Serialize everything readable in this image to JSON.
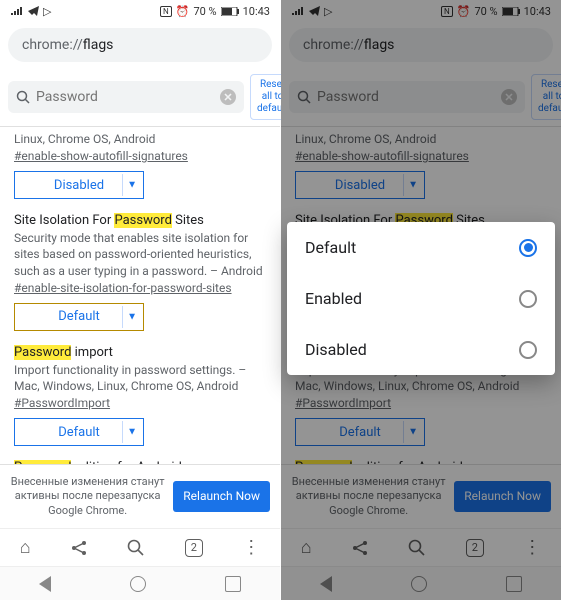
{
  "status": {
    "battery": "70 %",
    "time": "10:43"
  },
  "url": {
    "scheme": "chrome://",
    "path": "flags"
  },
  "search": {
    "placeholder": "Password"
  },
  "reset_btn": "Reset all to default",
  "flags": [
    {
      "title_plain": "Linux, Chrome OS, Android",
      "hash": "#enable-show-autofill-signatures",
      "dd": "Disabled",
      "dd_mod": false
    },
    {
      "title_pre": "Site Isolation For ",
      "title_hl": "Password",
      "title_post": " Sites",
      "desc": "Security mode that enables site isolation for sites based on password-oriented heuristics, such as a user typing in a password. – Android",
      "hash": "#enable-site-isolation-for-password-sites",
      "dd": "Default",
      "dd_mod": true
    },
    {
      "title_hl": "Password",
      "title_post": " import",
      "desc": "Import functionality in password settings. – Mac, Windows, Linux, Chrome OS, Android",
      "hash": "#PasswordImport",
      "dd": "Default",
      "dd_mod": false
    },
    {
      "title_hl": "Password",
      "title_post": " editing for Android"
    }
  ],
  "banner": {
    "txt": "Внесенные изменения станут активны после перезапуска Google Chrome.",
    "btn": "Relaunch Now"
  },
  "tabs_count": "2",
  "popup": {
    "options": [
      {
        "label": "Default",
        "sel": true
      },
      {
        "label": "Enabled",
        "sel": false
      },
      {
        "label": "Disabled",
        "sel": false
      }
    ]
  }
}
